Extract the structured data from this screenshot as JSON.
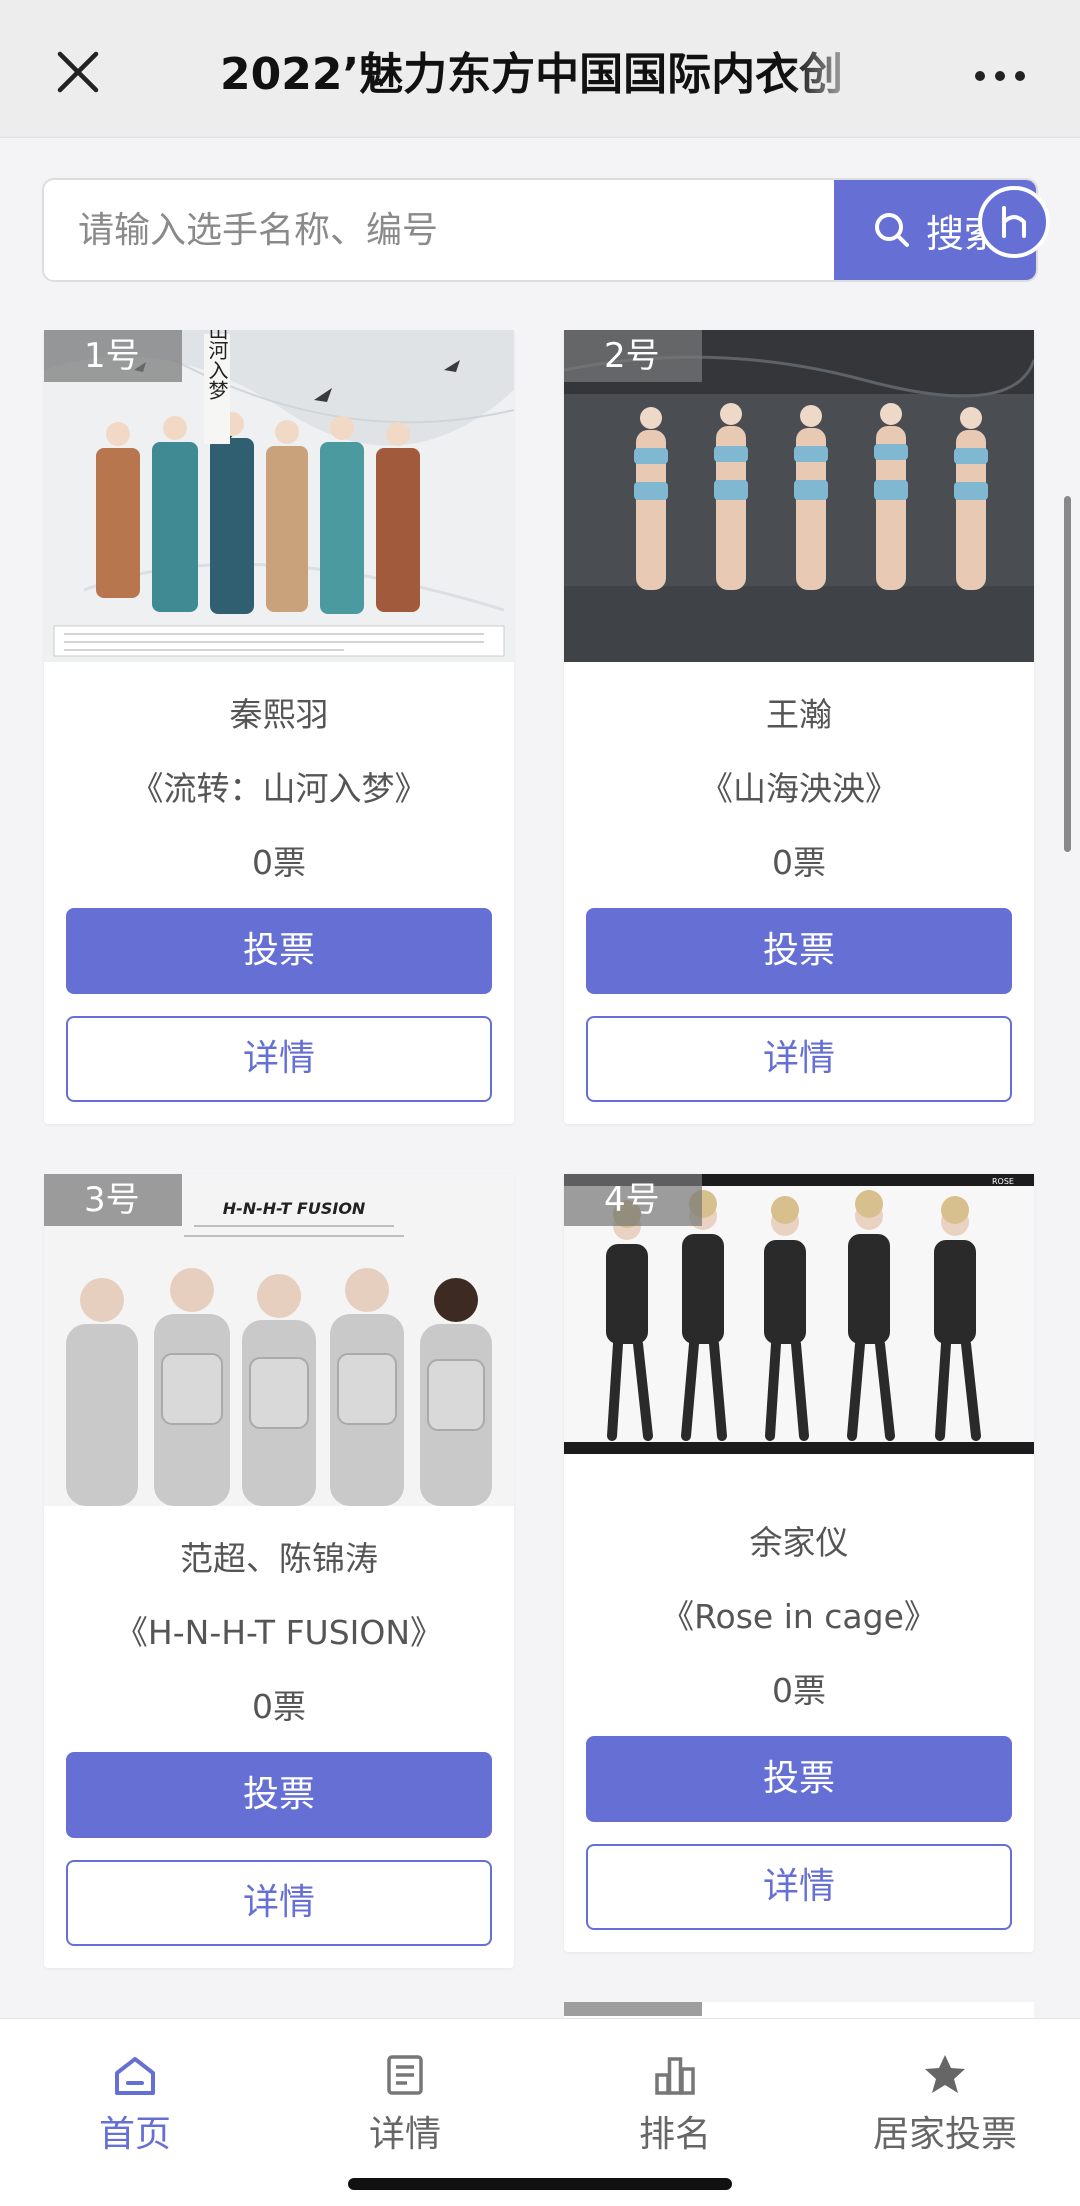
{
  "header": {
    "title": "2022’魅力东方中国国际内衣创"
  },
  "search": {
    "placeholder": "请输入选手名称、编号",
    "button_label": "搜索"
  },
  "cards": [
    {
      "num": "1号",
      "name": "秦熙羽",
      "work": "《流转：山河入梦》",
      "votes": "0票",
      "vote_label": "投票",
      "detail_label": "详情",
      "image_text": "山河入梦"
    },
    {
      "num": "2号",
      "name": "王瀚",
      "work": "《山海泱泱》",
      "votes": "0票",
      "vote_label": "投票",
      "detail_label": "详情",
      "image_text": ""
    },
    {
      "num": "3号",
      "name": "范超、陈锦涛",
      "work": "《H-N-H-T FUSION》",
      "votes": "0票",
      "vote_label": "投票",
      "detail_label": "详情",
      "image_text": "H-N-H-T FUSION"
    },
    {
      "num": "4号",
      "name": "余家仪",
      "work": "《Rose in cage》",
      "votes": "0票",
      "vote_label": "投票",
      "detail_label": "详情",
      "image_text": "ROSE"
    }
  ],
  "tabbar": [
    {
      "label": "首页",
      "icon": "home-icon",
      "active": true
    },
    {
      "label": "详情",
      "icon": "document-icon",
      "active": false
    },
    {
      "label": "排名",
      "icon": "ranking-icon",
      "active": false
    },
    {
      "label": "居家投票",
      "icon": "star-icon",
      "active": false
    }
  ],
  "colors": {
    "accent": "#6670d4",
    "background": "#f4f4f6"
  }
}
